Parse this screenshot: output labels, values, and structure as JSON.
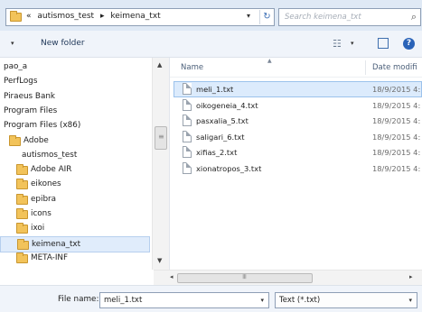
{
  "address": {
    "prefix": "«",
    "crumbs": [
      "autismos_test",
      "▸",
      "keimena_txt"
    ],
    "dropdown": "▾",
    "refresh": "↻"
  },
  "search": {
    "placeholder": "Search keimena_txt",
    "icon": "⌕"
  },
  "toolbar": {
    "organize_arrow": "▾",
    "new_folder": "New folder",
    "views_icon": "☷",
    "views_dropdown": "▾",
    "help": "?"
  },
  "nav": {
    "items": [
      {
        "label": "pao_a",
        "folder": false
      },
      {
        "label": "PerfLogs",
        "folder": false
      },
      {
        "label": "Piraeus Bank",
        "folder": false
      },
      {
        "label": "Program Files",
        "folder": false
      },
      {
        "label": "Program Files (x86)",
        "folder": false
      },
      {
        "label": "Adobe",
        "folder": true
      },
      {
        "label": "autismos_test",
        "folder": false
      },
      {
        "label": "Adobe AIR",
        "folder": true
      },
      {
        "label": "eikones",
        "folder": true
      },
      {
        "label": "epibra",
        "folder": true
      },
      {
        "label": "icons",
        "folder": true
      },
      {
        "label": "ixoi",
        "folder": true
      },
      {
        "label": "keimena_txt",
        "folder": true,
        "selected": true
      },
      {
        "label": "META-INF",
        "folder": true
      }
    ],
    "scroll_up": "▲",
    "scroll_down": "▼"
  },
  "list": {
    "col_name": "Name",
    "col_date": "Date modifi",
    "sort_caret": "▲",
    "files": [
      {
        "name": "meli_1.txt",
        "date": "18/9/2015 4:",
        "selected": true
      },
      {
        "name": "oikogeneia_4.txt",
        "date": "18/9/2015 4:"
      },
      {
        "name": "pasxalia_5.txt",
        "date": "18/9/2015 4:"
      },
      {
        "name": "saligari_6.txt",
        "date": "18/9/2015 4:"
      },
      {
        "name": "xifias_2.txt",
        "date": "18/9/2015 4:"
      },
      {
        "name": "xionatropos_3.txt",
        "date": "18/9/2015 4:"
      }
    ],
    "hscroll_left": "◂",
    "hscroll_right": "▸"
  },
  "bottom": {
    "filename_label": "File name:",
    "filename_value": "meli_1.txt",
    "filename_dropdown": "▾",
    "filetype_value": "Text (*.txt)",
    "filetype_dropdown": "▾"
  }
}
